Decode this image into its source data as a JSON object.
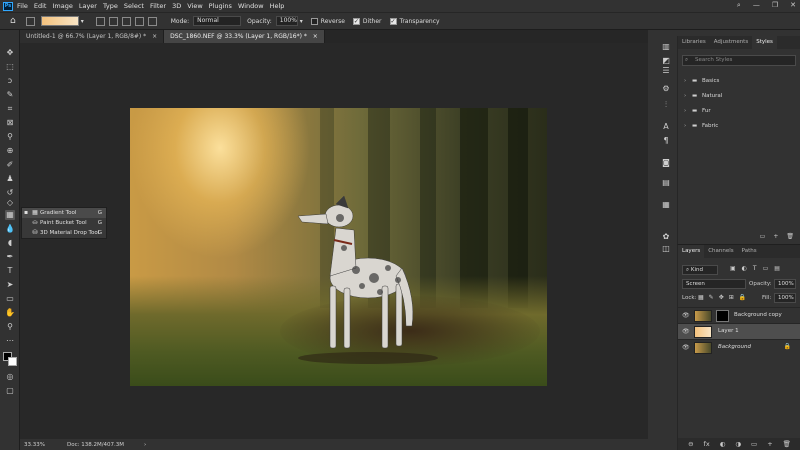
{
  "app": {
    "logo": "Ps"
  },
  "menu": [
    "File",
    "Edit",
    "Image",
    "Layer",
    "Type",
    "Select",
    "Filter",
    "3D",
    "View",
    "Plugins",
    "Window",
    "Help"
  ],
  "window_controls": {
    "search": "⌕",
    "minimize": "—",
    "maximize": "❐",
    "close": "✕"
  },
  "options": {
    "mode_label": "Mode:",
    "mode_value": "Normal",
    "opacity_label": "Opacity:",
    "opacity_value": "100%",
    "reverse_label": "Reverse",
    "dither_label": "Dither",
    "transparency_label": "Transparency",
    "gradient_colors": [
      "#f4c27e",
      "#f8e4c4"
    ]
  },
  "tabs": [
    {
      "label": "Untitled-1 @ 66.7% (Layer 1, RGB/8#) *",
      "close": "×"
    },
    {
      "label": "DSC_1860.NEF @ 33.3% (Layer 1, RGB/16*) *",
      "close": "×"
    }
  ],
  "flyout": [
    {
      "label": "Gradient Tool",
      "key": "G",
      "icon": "gradient-icon"
    },
    {
      "label": "Paint Bucket Tool",
      "key": "G",
      "icon": "paint-bucket-icon"
    },
    {
      "label": "3D Material Drop Tool",
      "key": "G",
      "icon": "material-drop-icon"
    }
  ],
  "status": {
    "zoom": "33.33%",
    "doc": "Doc: 138.2M/407.3M",
    "arrow": "›"
  },
  "styles_panel": {
    "tabs": [
      "Libraries",
      "Adjustments",
      "Styles"
    ],
    "search_placeholder": "Search Styles",
    "folders": [
      "Basics",
      "Natural",
      "Fur",
      "Fabric"
    ]
  },
  "layers_panel": {
    "tabs": [
      "Layers",
      "Channels",
      "Paths"
    ],
    "kind_label": "Kind",
    "blend_mode": "Screen",
    "opacity_label": "Opacity:",
    "opacity_value": "100%",
    "lock_label": "Lock:",
    "fill_label": "Fill:",
    "fill_value": "100%",
    "layers": [
      {
        "name": "Background copy",
        "selected": false,
        "has_mask": true
      },
      {
        "name": "Layer 1",
        "selected": true,
        "has_mask": false
      },
      {
        "name": "Background",
        "selected": false,
        "has_mask": false,
        "locked": true
      }
    ],
    "bottom_icons": [
      "⊖",
      "fx",
      "◐",
      "◑",
      "▭",
      "+",
      "🗑"
    ]
  }
}
